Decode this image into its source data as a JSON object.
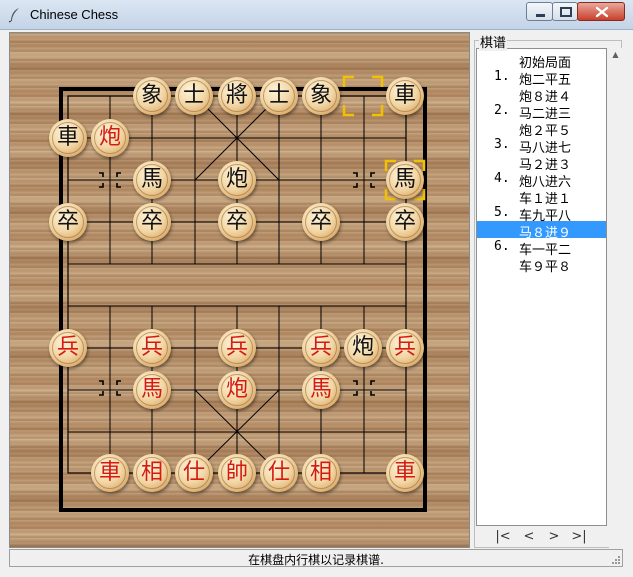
{
  "window": {
    "title": "Chinese Chess"
  },
  "board": {
    "pieces": [
      {
        "id": "b-chariot-right",
        "char": "車",
        "side": "black"
      },
      {
        "id": "b-elephant-left",
        "char": "象",
        "side": "black"
      },
      {
        "id": "b-advisor-left",
        "char": "士",
        "side": "black"
      },
      {
        "id": "b-general",
        "char": "將",
        "side": "black"
      },
      {
        "id": "b-advisor-right",
        "char": "士",
        "side": "black"
      },
      {
        "id": "b-elephant-right",
        "char": "象",
        "side": "black"
      },
      {
        "id": "b-chariot-left",
        "char": "車",
        "side": "black"
      },
      {
        "id": "b-cannon-left",
        "char": "炮",
        "side": "red"
      },
      {
        "id": "b-horse-left",
        "char": "馬",
        "side": "black"
      },
      {
        "id": "b-cannon-center",
        "char": "炮",
        "side": "black"
      },
      {
        "id": "b-horse-right",
        "char": "馬",
        "side": "black"
      },
      {
        "id": "b-soldier-1",
        "char": "卒",
        "side": "black"
      },
      {
        "id": "b-soldier-2",
        "char": "卒",
        "side": "black"
      },
      {
        "id": "b-soldier-3",
        "char": "卒",
        "side": "black"
      },
      {
        "id": "b-soldier-4",
        "char": "卒",
        "side": "black"
      },
      {
        "id": "b-soldier-5",
        "char": "卒",
        "side": "black"
      },
      {
        "id": "r-soldier-1",
        "char": "兵",
        "side": "red"
      },
      {
        "id": "r-soldier-2",
        "char": "兵",
        "side": "red"
      },
      {
        "id": "r-soldier-3",
        "char": "兵",
        "side": "red"
      },
      {
        "id": "r-soldier-4",
        "char": "兵",
        "side": "red"
      },
      {
        "id": "b-cannon-advanced",
        "char": "炮",
        "side": "black"
      },
      {
        "id": "r-soldier-5",
        "char": "兵",
        "side": "red"
      },
      {
        "id": "r-horse-left",
        "char": "馬",
        "side": "red"
      },
      {
        "id": "r-cannon-center",
        "char": "炮",
        "side": "red"
      },
      {
        "id": "r-horse-right",
        "char": "馬",
        "side": "red"
      },
      {
        "id": "r-chariot-left",
        "char": "車",
        "side": "red"
      },
      {
        "id": "r-elephant-left",
        "char": "相",
        "side": "red"
      },
      {
        "id": "r-advisor-left",
        "char": "仕",
        "side": "red"
      },
      {
        "id": "r-general",
        "char": "帥",
        "side": "red"
      },
      {
        "id": "r-advisor-right",
        "char": "仕",
        "side": "red"
      },
      {
        "id": "r-elephant-right",
        "char": "相",
        "side": "red"
      },
      {
        "id": "r-chariot-right",
        "char": "車",
        "side": "red"
      }
    ]
  },
  "movelist": {
    "label": "棋谱",
    "rows": [
      {
        "num": "",
        "move": "初始局面",
        "selected": false
      },
      {
        "num": "1.",
        "move": "炮二平五",
        "selected": false
      },
      {
        "num": "",
        "move": "炮８进４",
        "selected": false
      },
      {
        "num": "2.",
        "move": "马二进三",
        "selected": false
      },
      {
        "num": "",
        "move": "炮２平５",
        "selected": false
      },
      {
        "num": "3.",
        "move": "马八进七",
        "selected": false
      },
      {
        "num": "",
        "move": "马２进３",
        "selected": false
      },
      {
        "num": "4.",
        "move": "炮八进六",
        "selected": false
      },
      {
        "num": "",
        "move": "车１进１",
        "selected": false
      },
      {
        "num": "5.",
        "move": "车九平八",
        "selected": false
      },
      {
        "num": "",
        "move": "马８进９",
        "selected": true
      },
      {
        "num": "6.",
        "move": "车一平二",
        "selected": false
      },
      {
        "num": "",
        "move": "车９平８",
        "selected": false
      }
    ],
    "nav": {
      "first": "|<",
      "prev": "<",
      "next": ">",
      "last": ">|"
    }
  },
  "status": {
    "text": "在棋盘内行棋以记录棋谱."
  },
  "colors": {
    "selection": "#3399ff",
    "red_piece": "#d41a12",
    "black_piece": "#111111",
    "highlight": "#f2c200"
  }
}
